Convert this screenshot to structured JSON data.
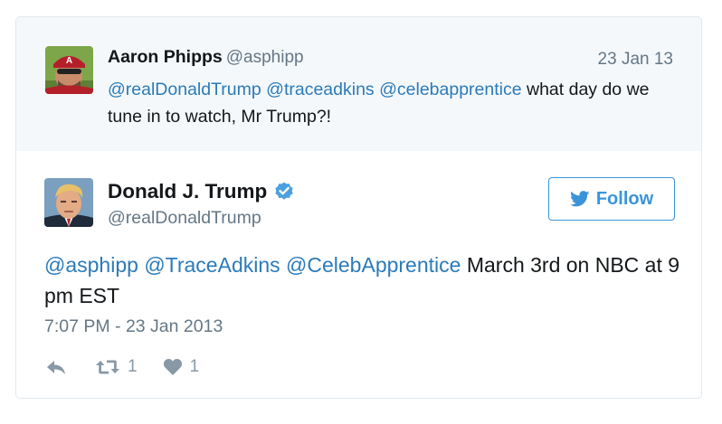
{
  "quoted_tweet": {
    "author_name": "Aaron Phipps",
    "author_handle": "@asphipp",
    "date": "23 Jan 13",
    "mentions": [
      "@realDonaldTrump",
      "@traceadkins",
      "@celebapprentice"
    ],
    "text_rest": " what day do we tune in to watch, Mr Trump?!"
  },
  "main_tweet": {
    "author_name": "Donald J. Trump",
    "author_handle": "@realDonaldTrump",
    "verified": true,
    "follow_label": "Follow",
    "mentions": [
      "@asphipp",
      "@TraceAdkins",
      "@CelebApprentice"
    ],
    "text_rest": " March 3rd on NBC at 9 pm EST",
    "timestamp": "7:07 PM - 23 Jan 2013"
  },
  "actions": {
    "retweet_count": "1",
    "like_count": "1"
  },
  "colors": {
    "link": "#2b7bb9",
    "follow": "#3b94d9",
    "muted": "#657786",
    "quoted_bg": "#f5f8fa"
  }
}
